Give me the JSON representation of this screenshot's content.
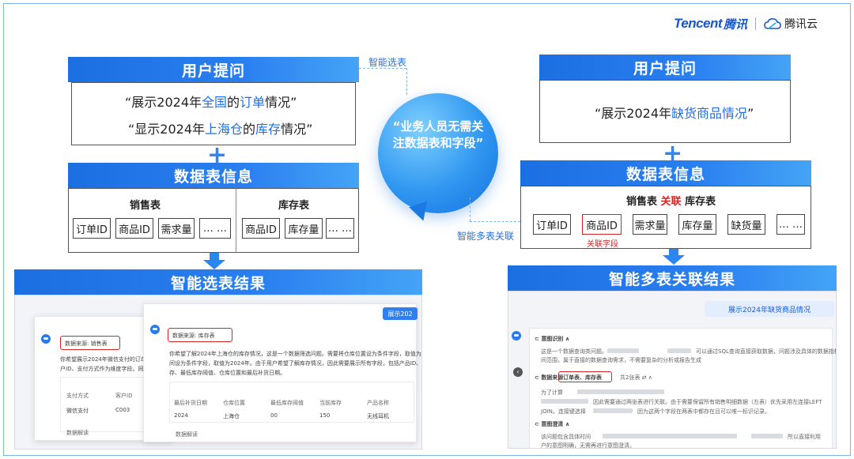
{
  "brand": {
    "tencent": "Tencent",
    "tencent_cn": "腾讯",
    "cloud": "腾讯云"
  },
  "left": {
    "question_title": "用户提问",
    "q1": {
      "a": "“展示2024年",
      "b": "全国",
      "c": "的",
      "d": "订单",
      "e": "情况”"
    },
    "q2": {
      "a": "“显示2024年",
      "b": "上海仓",
      "c": "的",
      "d": "库存",
      "e": "情况”"
    },
    "plus": "+",
    "table_title": "数据表信息",
    "sales_table": "销售表",
    "inventory_table": "库存表",
    "sales_fields": [
      "订单ID",
      "商品ID",
      "需求量",
      "… …"
    ],
    "inventory_fields": [
      "商品ID",
      "库存量",
      "… …"
    ],
    "result_title": "智能选表结果"
  },
  "center": {
    "bubble_text": "“业务人员无需关注数据表和字段”",
    "label_top": "智能选表",
    "label_bottom": "智能多表关联"
  },
  "right": {
    "question_title": "用户提问",
    "q1": {
      "a": "“展示2024年",
      "b": "缺货商品情况",
      "c": "”"
    },
    "plus": "+",
    "table_title": "数据表信息",
    "tables_line": {
      "a": "销售表",
      "b": "关联",
      "c": "库存表"
    },
    "fields": [
      "订单ID",
      "商品ID",
      "需求量",
      "库存量",
      "缺货量",
      "… …"
    ],
    "join_field_note": "关联字段",
    "result_title": "智能多表关联结果"
  },
  "left_shot": {
    "back_button": "展示202",
    "back_source": "数据来源: 销售表",
    "back_text_1": "你希望展示2024年微信支付的订单",
    "back_text_2": "户ID、支付方式作为维度字段。同",
    "back_cols": [
      "支付方式",
      "客户ID"
    ],
    "back_row": [
      "微信支付",
      "C003"
    ],
    "back_footer": "数据解读",
    "front_source": "数据来源: 库存表",
    "front_text_1": "你希望了解2024年上海仓的库存情况，这是一个数据筛选问题。需要将仓库位置设为条件字段，取值为",
    "front_text_2": "间设为条件字段，取值为2024年。由于用户希望了解库存情况，因此需要展示所有字段，包括产品ID、",
    "front_text_3": "存、最低库存阈值、仓库位置和最后补货日期。",
    "front_cols": [
      "最后补货日期",
      "仓库位置",
      "最低库存阈值",
      "当前库存",
      "产品名称"
    ],
    "front_row": [
      "2024",
      "上海仓",
      "00",
      "150",
      "无线耳机"
    ],
    "front_footer": "数据解读"
  },
  "right_shot": {
    "header": "展示2024年缺货商品情况",
    "intent": "意图识别",
    "intent_text_1": "这是一个数据查询类问题。",
    "intent_text_1b": "可以通过SQL查询直接获取数据，问题涉及具体的数据指标和时",
    "intent_text_2": "间范围，属于直接的数据查询需求，不需要复杂的分析或报告生成",
    "source_label": "数据来源",
    "source_tables": "订单表、库存表",
    "source_count": "共2张表",
    "join_text_1": "为了计算",
    "join_text_2": "因此需要通过两张表进行关联。由于需要保留所有销售明细数据（左表）优先采用左连接LEFT",
    "join_text_3": "JOIN。连接键选择",
    "join_text_4": "因为这两个字段在两表中都存在且可以唯一标识记录。",
    "clarify": "意图澄清",
    "clarify_text_1": "该问题包含具体时间",
    "clarify_text_1b": "所以直接利用",
    "clarify_text_2": "户的意图明确，无需再进行意图澄清。"
  },
  "colors": {
    "accent": "#1e6fe6",
    "highlight_red": "#d52424",
    "bar_blue": "#2a7ff0"
  }
}
